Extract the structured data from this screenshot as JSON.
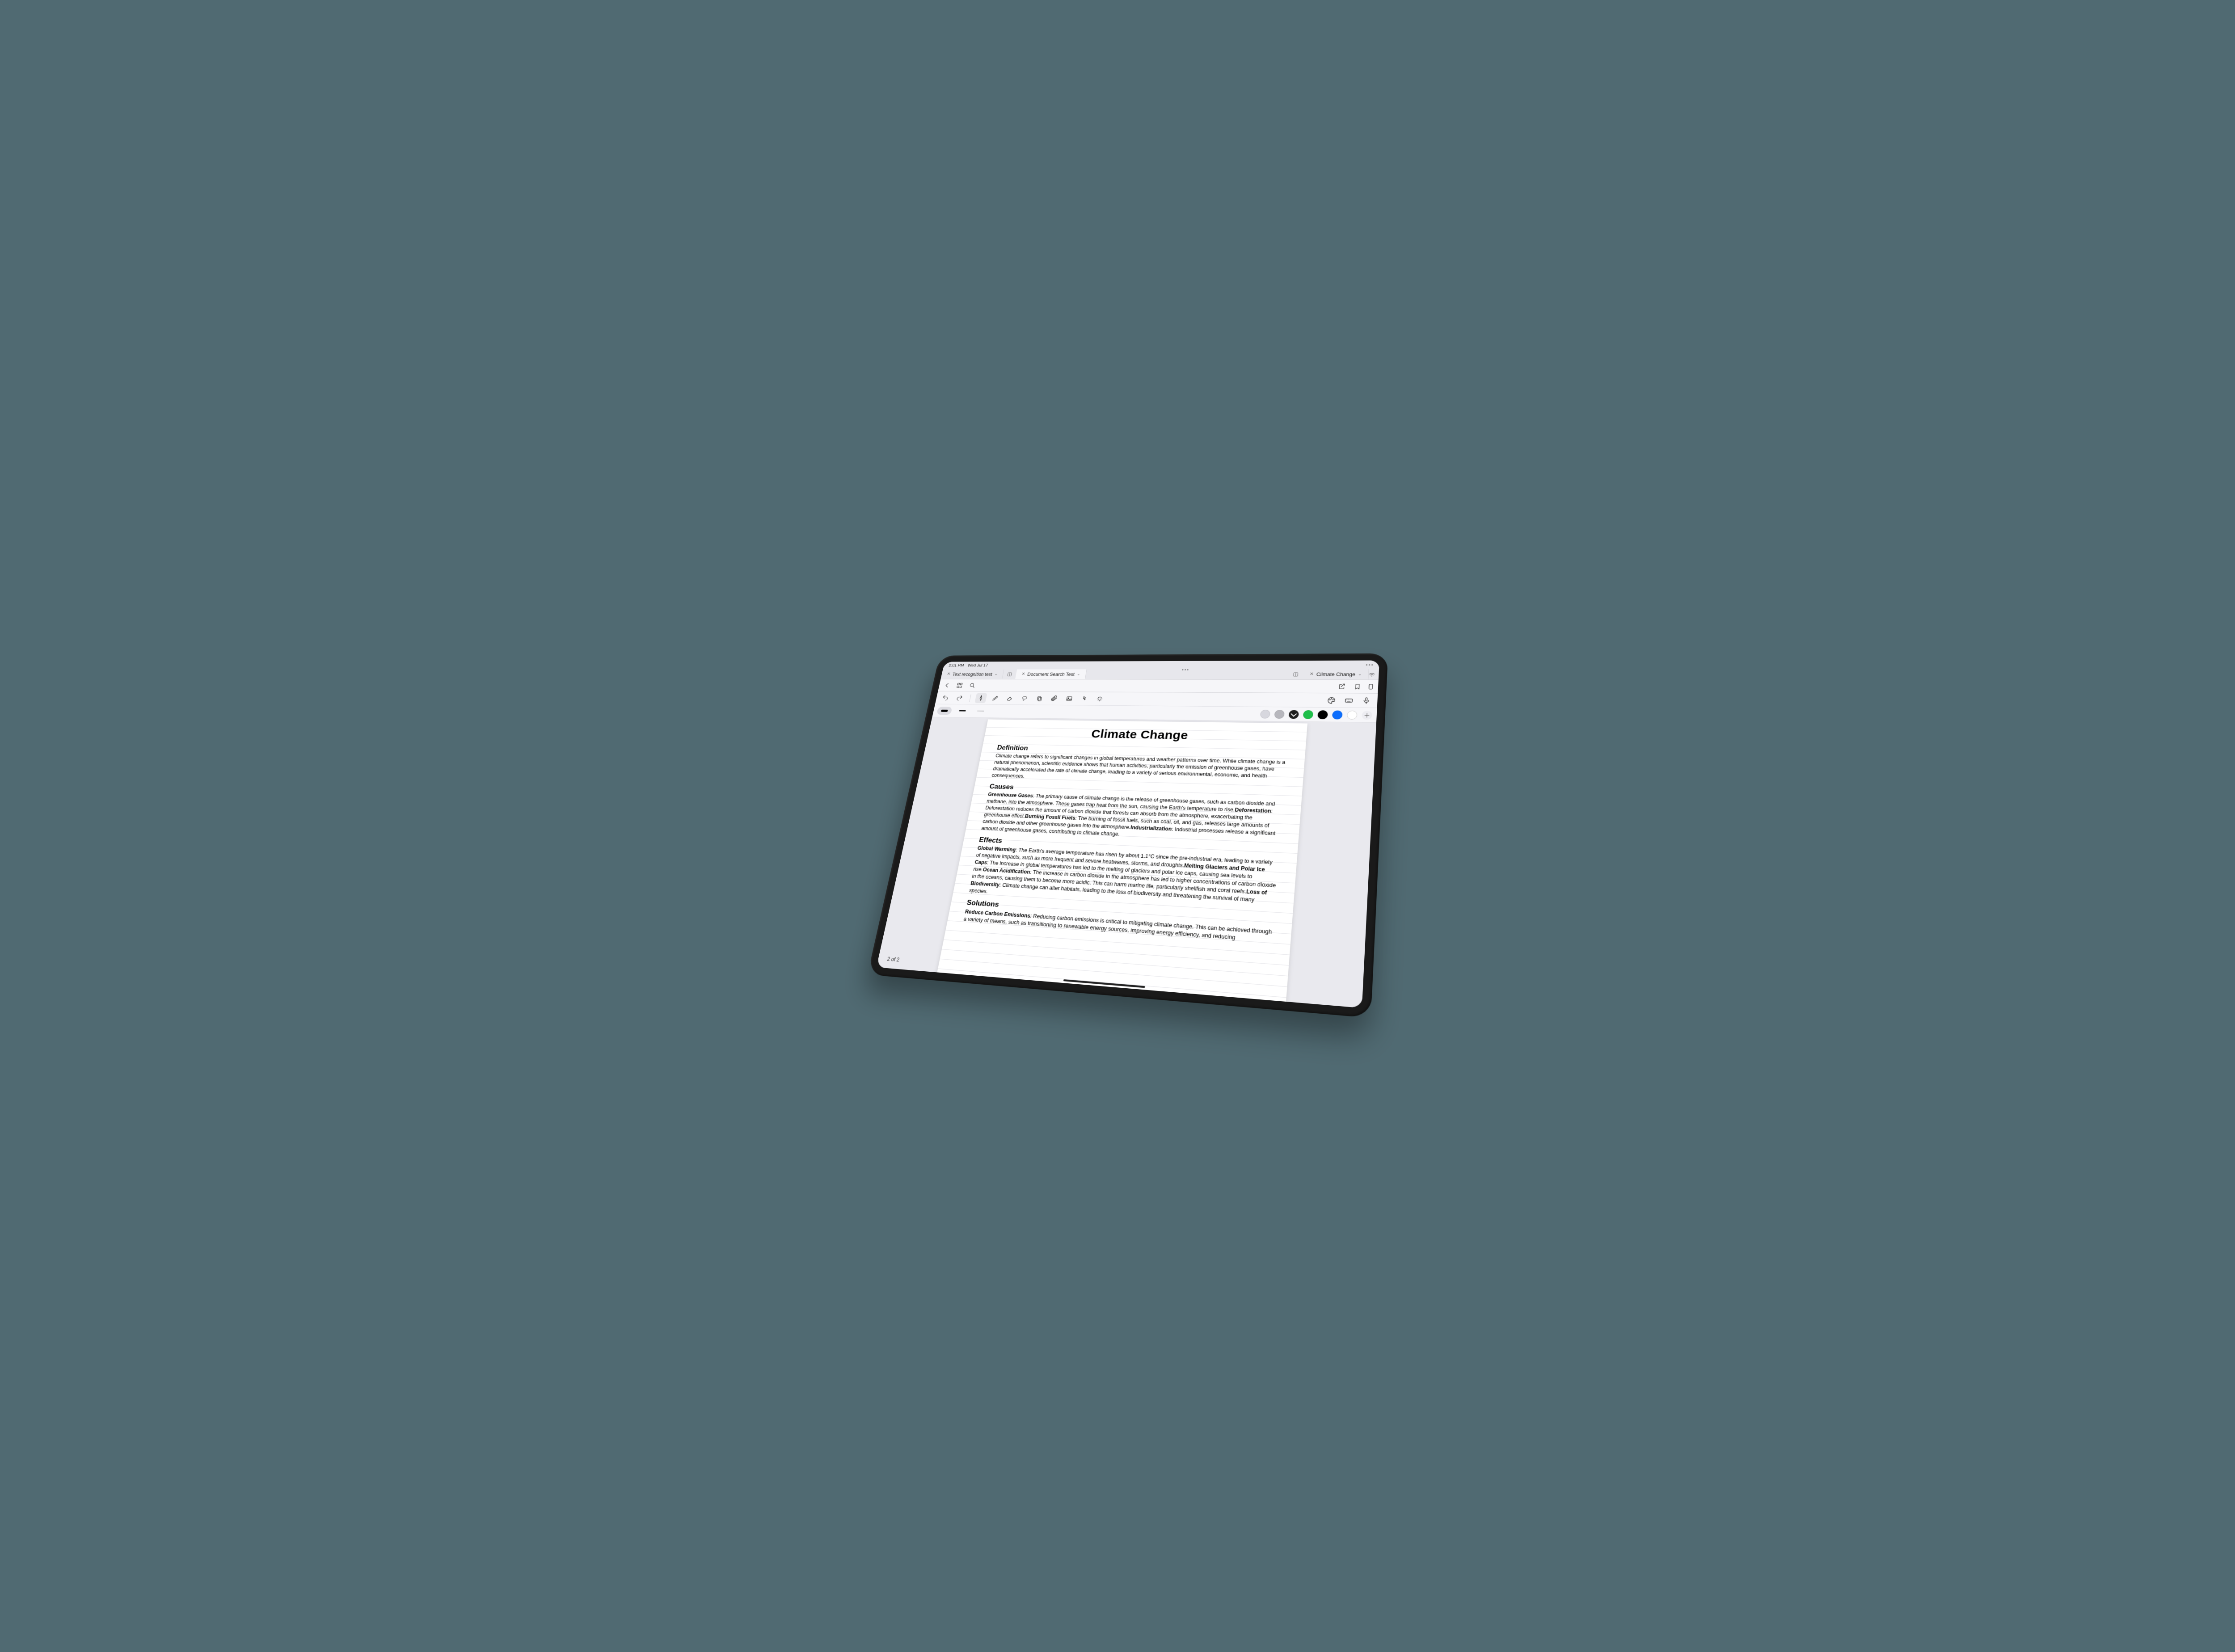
{
  "status": {
    "time": "2:01 PM",
    "date": "Wed Jul 17"
  },
  "tabs": [
    {
      "label": "Text recognition test"
    },
    {
      "label": "Document Search Test"
    },
    {
      "label": "Climate Change"
    }
  ],
  "page": {
    "current": 2,
    "total": 2,
    "text": "2 of 2"
  },
  "colors": {
    "swatch_light_gray": "#d7d7de",
    "swatch_gray": "#b7b7bd",
    "swatch_dropdown": "#1d1d1d",
    "swatch_green": "#1fbf4a",
    "swatch_black": "#000000",
    "swatch_blue": "#0d6efd",
    "swatch_white": "#ffffff"
  },
  "stroke_sizes": [
    {
      "name": "thick",
      "w": 18,
      "h": 6
    },
    {
      "name": "medium",
      "w": 18,
      "h": 3
    },
    {
      "name": "thin",
      "w": 18,
      "h": 1.5
    }
  ],
  "doc": {
    "title": "Climate Change",
    "sections": {
      "definition": {
        "heading": "Definition",
        "body": "Climate change refers to significant changes in global temperatures and weather patterns over time. While climate change is a natural phenomenon, scientific evidence shows that human activities, particularly the emission of greenhouse gases, have dramatically accelerated the rate of climate change, leading to a variety of serious environmental, economic, and health consequences."
      },
      "causes": {
        "heading": "Causes",
        "runs": [
          {
            "bold": "Greenhouse Gases",
            "text": ": The primary cause of climate change is the release of greenhouse gases, such as carbon dioxide and methane, into the atmosphere. These gases trap heat from the sun, causing the Earth's temperature to rise."
          },
          {
            "bold": "Deforestation",
            "text": ": Deforestation reduces the amount of carbon dioxide that forests can absorb from the atmosphere, exacerbating the greenhouse effect."
          },
          {
            "bold": "Burning Fossil Fuels",
            "text": ": The burning of fossil fuels, such as coal, oil, and gas, releases large amounts of carbon dioxide and other greenhouse gases into the atmosphere."
          },
          {
            "bold": "Industrialization",
            "text": ": Industrial processes release a significant amount of greenhouse gases, contributing to climate change."
          }
        ]
      },
      "effects": {
        "heading": "Effects",
        "runs": [
          {
            "bold": "Global Warming",
            "text": ": The Earth's average temperature has risen by about 1.1°C since the pre-industrial era, leading to a variety of negative impacts, such as more frequent and severe heatwaves, storms, and droughts."
          },
          {
            "bold": "Melting Glaciers and Polar Ice Caps",
            "text": ": The increase in global temperatures has led to the melting of glaciers and polar ice caps, causing sea levels to rise."
          },
          {
            "bold": "Ocean Acidification",
            "text": ": The increase in carbon dioxide in the atmosphere has led to higher concentrations of carbon dioxide in the oceans, causing them to become more acidic. This can harm marine life, particularly shellfish and coral reefs."
          },
          {
            "bold": "Loss of Biodiversity",
            "text": ": Climate change can alter habitats, leading to the loss of biodiversity and threatening the survival of many species."
          }
        ]
      },
      "solutions": {
        "heading": "Solutions",
        "runs": [
          {
            "bold": "Reduce Carbon Emissions",
            "text": ": Reducing carbon emissions is critical to mitigating climate change. This can be achieved through a variety of means, such as transitioning to renewable energy sources, improving energy efficiency, and reducing"
          }
        ]
      }
    }
  }
}
